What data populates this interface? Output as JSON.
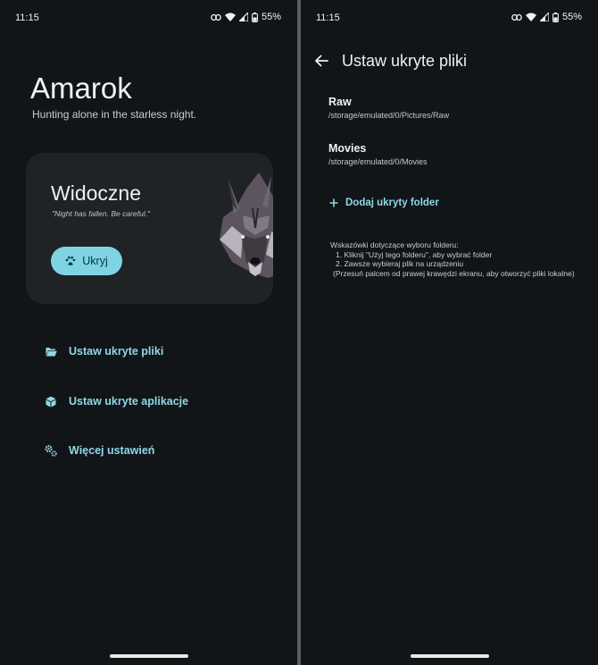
{
  "status_bar": {
    "time": "11:15",
    "battery_percent": "55%"
  },
  "home": {
    "app_title": "Amarok",
    "tagline": "Hunting alone in the starless night.",
    "status_card": {
      "title": "Widoczne",
      "subtitle": "\"Night has fallen. Be careful.\"",
      "hide_button_label": "Ukryj",
      "hide_button_icon": "paw-icon",
      "wolf_image": "wolf-head"
    },
    "menu": [
      {
        "label": "Ustaw ukryte pliki",
        "icon": "folder-open-icon"
      },
      {
        "label": "Ustaw ukryte aplikacje",
        "icon": "cube-icon"
      },
      {
        "label": "Więcej ustawień",
        "icon": "gears-icon"
      }
    ]
  },
  "hidden_files": {
    "title": "Ustaw ukryte pliki",
    "folders": [
      {
        "name": "Raw",
        "path": "/storage/emulated/0/Pictures/Raw"
      },
      {
        "name": "Movies",
        "path": "/storage/emulated/0/Movies"
      }
    ],
    "add_folder_label": "Dodaj ukryty folder",
    "hints": {
      "heading": "Wskazówki dotyczące wyboru folderu:",
      "steps": [
        "1. Kliknij \"Użyj tego folderu\", aby wybrać folder",
        "2. Zawsze wybieraj plik na urządzeniu"
      ],
      "note": "(Przesuń palcem od prawej krawędzi ekranu, aby otworzyć pliki lokalne)"
    }
  },
  "colors": {
    "background": "#111518",
    "card": "#1f2326",
    "accent": "#7fd4e3",
    "accent_text": "#8fd8e6"
  }
}
